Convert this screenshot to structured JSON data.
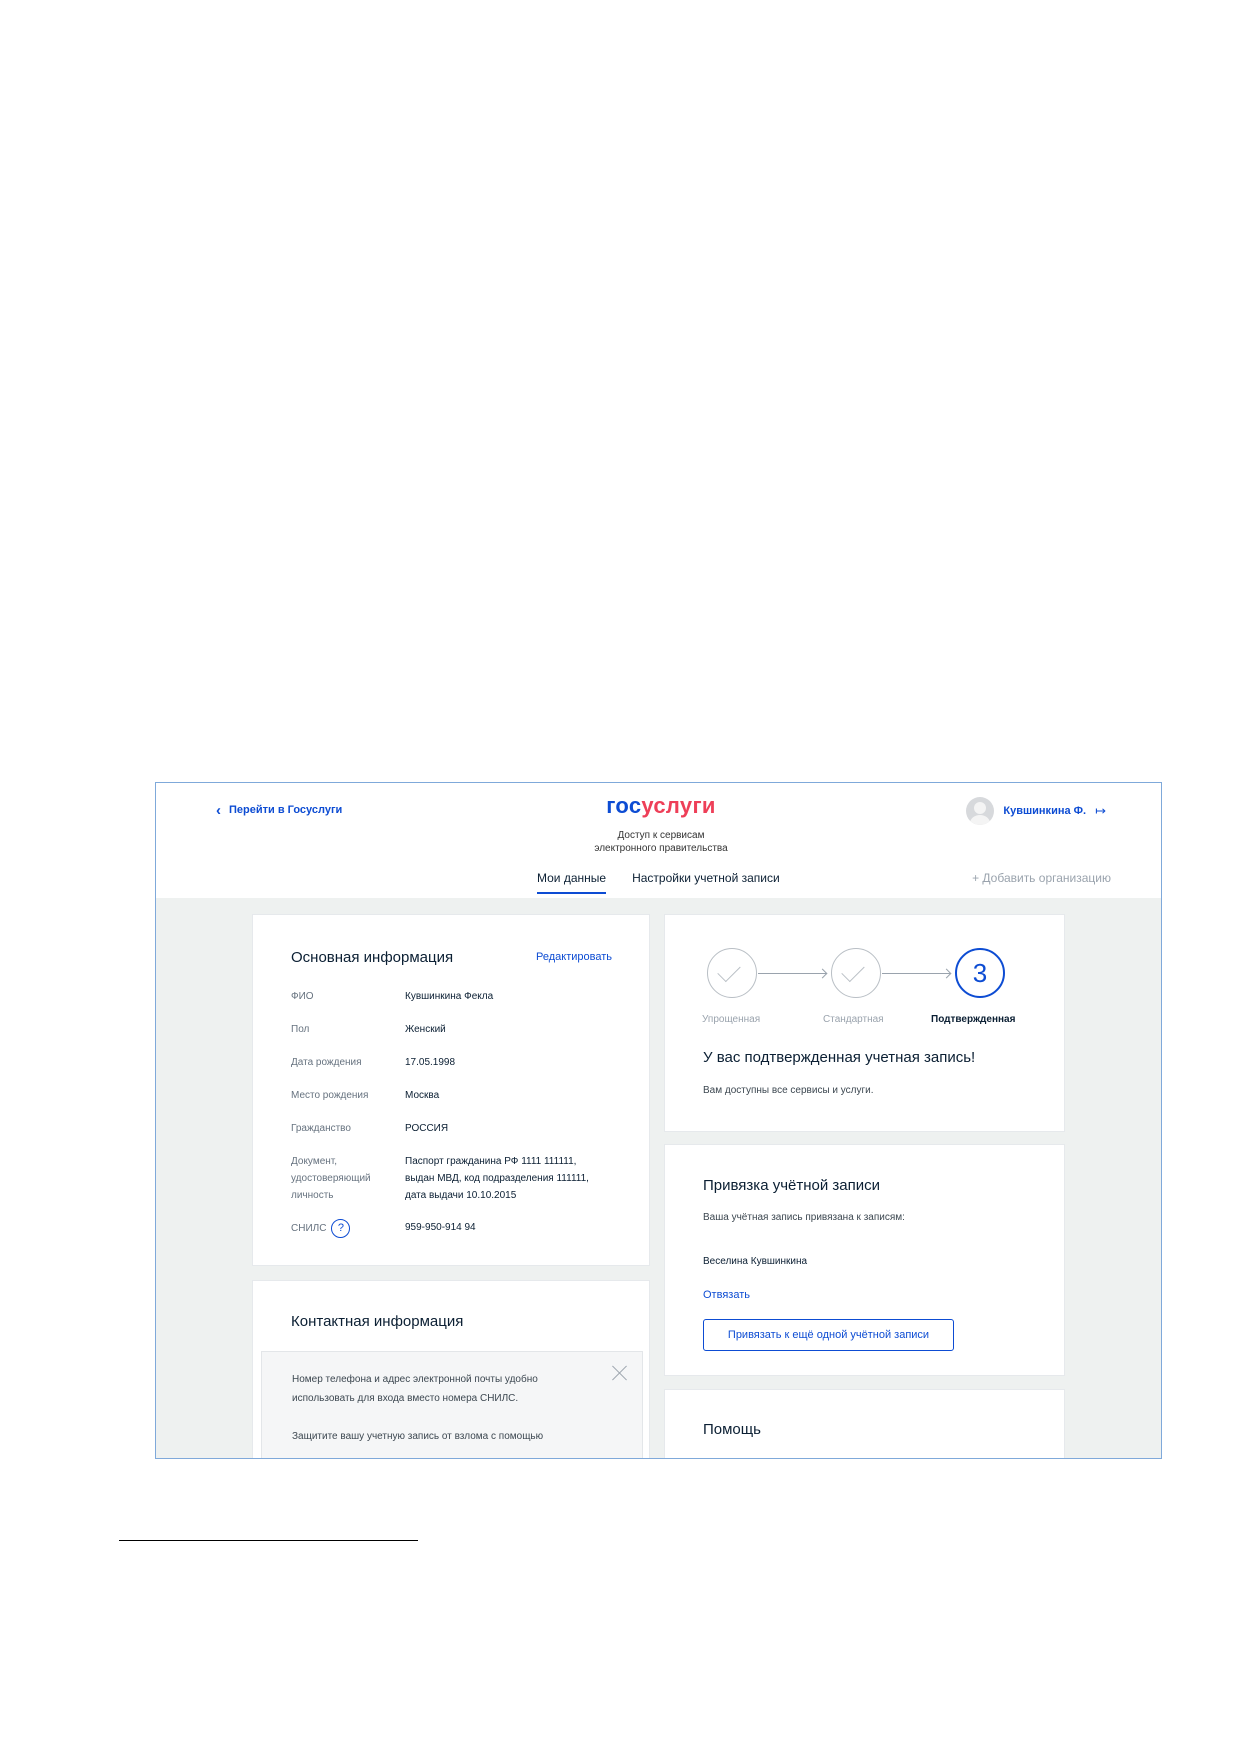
{
  "header": {
    "back_link": "Перейти в Госуслуги",
    "logo_part1": "гос",
    "logo_part2": "услуги",
    "tagline_line1": "Доступ к сервисам",
    "tagline_line2": "электронного правительства",
    "user_name": "Кувшинкина Ф.",
    "tabs": [
      {
        "label": "Мои данные",
        "active": true
      },
      {
        "label": "Настройки учетной записи",
        "active": false
      }
    ],
    "add_org": "+ Добавить организацию"
  },
  "main_info": {
    "title": "Основная информация",
    "edit_link": "Редактировать",
    "rows": [
      {
        "label": "ФИО",
        "value": "Кувшинкина Фекла"
      },
      {
        "label": "Пол",
        "value": "Женский"
      },
      {
        "label": "Дата рождения",
        "value": "17.05.1998"
      },
      {
        "label": "Место рождения",
        "value": "Москва"
      },
      {
        "label": "Гражданство",
        "value": "РОССИЯ"
      },
      {
        "label_lines": [
          "Документ,",
          "удостоверяющий",
          "личность"
        ],
        "value_lines": [
          "Паспорт гражданина РФ 1111 111111,",
          "выдан МВД, код подразделения 111111,",
          "дата выдачи 10.10.2015"
        ]
      },
      {
        "label": "СНИЛС",
        "value": "959-950-914 94"
      }
    ],
    "help_glyph": "?"
  },
  "contact_info": {
    "title": "Контактная информация",
    "notice_line1": "Номер телефона и адрес электронной почты удобно",
    "notice_line2": "использовать для входа вместо номера СНИЛС.",
    "notice_line3": "Защитите вашу учетную запись от взлома с помощью"
  },
  "account_status": {
    "steps": [
      {
        "label": "Упрощенная",
        "state": "done"
      },
      {
        "label": "Стандартная",
        "state": "done"
      },
      {
        "label": "Подтвержденная",
        "state": "active",
        "number": "3"
      }
    ],
    "heading": "У вас подтвержденная учетная запись!",
    "text": "Вам доступны все сервисы и услуги."
  },
  "account_link": {
    "title": "Привязка учётной записи",
    "text": "Ваша учётная запись привязана к записям:",
    "linked_name": "Веселина Кувшинкина",
    "unlink": "Отвязать",
    "button": "Привязать к ещё одной учётной записи"
  },
  "help": {
    "title": "Помощь"
  },
  "colors": {
    "accent": "#0d4cd3",
    "logo_red": "#ee3f58",
    "background": "#eef1f0"
  }
}
